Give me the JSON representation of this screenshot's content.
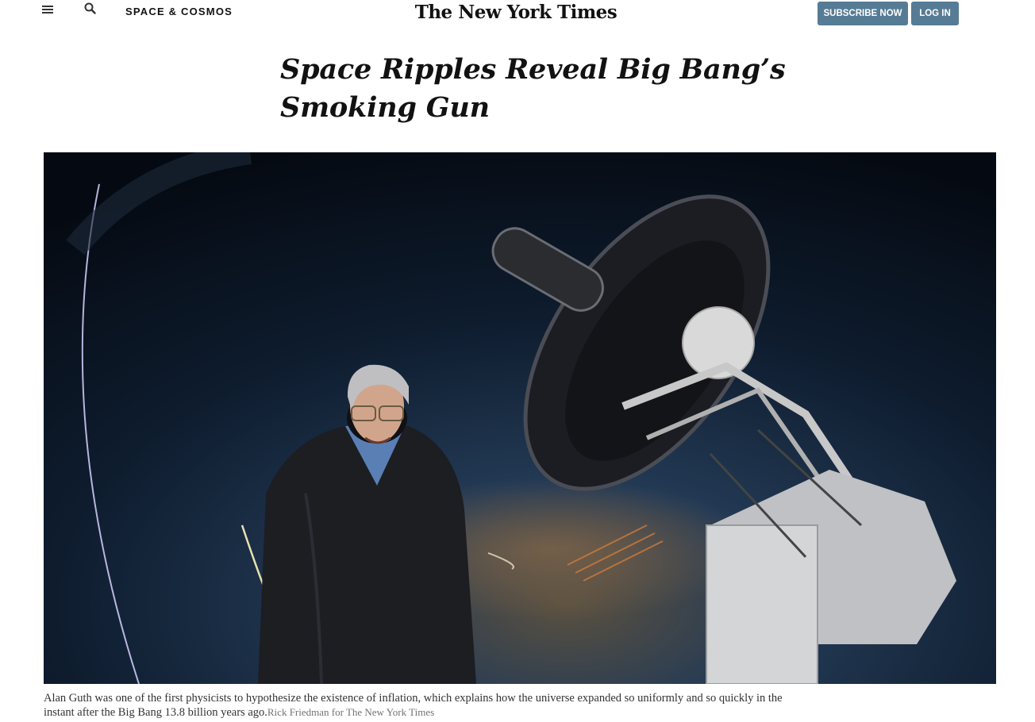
{
  "header": {
    "section": "SPACE & COSMOS",
    "masthead": "The New York Times",
    "subscribe_label": "SUBSCRIBE NOW",
    "login_label": "LOG IN",
    "menu_icon": "hamburger-menu-icon",
    "search_icon": "search-icon",
    "button_color": "#567b95"
  },
  "article": {
    "headline": "Space Ripples Reveal Big Bang’s Smoking Gun",
    "image_caption": "Alan Guth was one of the first physicists to hypothesize the existence of inflation, which explains how the universe expanded so uniformly and so quickly in the instant after the Big Bang 13.8 billion years ago.",
    "image_credit": "Rick Friedman for The New York Times"
  }
}
